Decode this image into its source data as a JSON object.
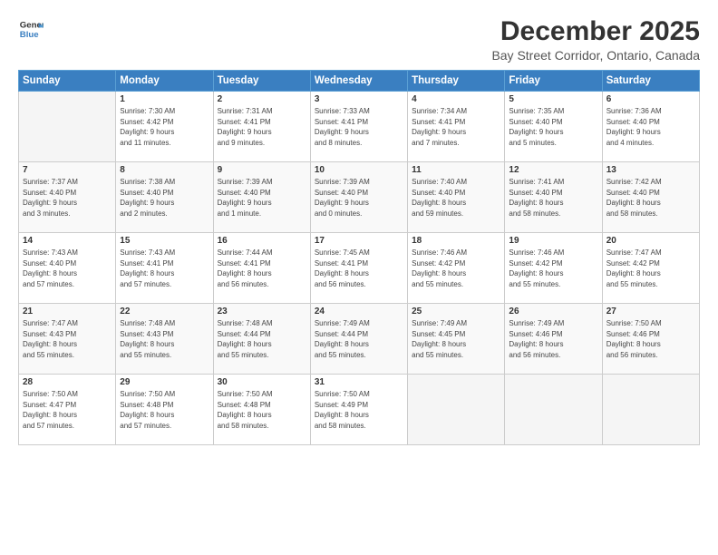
{
  "logo": {
    "general": "General",
    "blue": "Blue"
  },
  "title": "December 2025",
  "subtitle": "Bay Street Corridor, Ontario, Canada",
  "days_header": [
    "Sunday",
    "Monday",
    "Tuesday",
    "Wednesday",
    "Thursday",
    "Friday",
    "Saturday"
  ],
  "weeks": [
    [
      {
        "day": "",
        "info": ""
      },
      {
        "day": "1",
        "info": "Sunrise: 7:30 AM\nSunset: 4:42 PM\nDaylight: 9 hours\nand 11 minutes."
      },
      {
        "day": "2",
        "info": "Sunrise: 7:31 AM\nSunset: 4:41 PM\nDaylight: 9 hours\nand 9 minutes."
      },
      {
        "day": "3",
        "info": "Sunrise: 7:33 AM\nSunset: 4:41 PM\nDaylight: 9 hours\nand 8 minutes."
      },
      {
        "day": "4",
        "info": "Sunrise: 7:34 AM\nSunset: 4:41 PM\nDaylight: 9 hours\nand 7 minutes."
      },
      {
        "day": "5",
        "info": "Sunrise: 7:35 AM\nSunset: 4:40 PM\nDaylight: 9 hours\nand 5 minutes."
      },
      {
        "day": "6",
        "info": "Sunrise: 7:36 AM\nSunset: 4:40 PM\nDaylight: 9 hours\nand 4 minutes."
      }
    ],
    [
      {
        "day": "7",
        "info": "Sunrise: 7:37 AM\nSunset: 4:40 PM\nDaylight: 9 hours\nand 3 minutes."
      },
      {
        "day": "8",
        "info": "Sunrise: 7:38 AM\nSunset: 4:40 PM\nDaylight: 9 hours\nand 2 minutes."
      },
      {
        "day": "9",
        "info": "Sunrise: 7:39 AM\nSunset: 4:40 PM\nDaylight: 9 hours\nand 1 minute."
      },
      {
        "day": "10",
        "info": "Sunrise: 7:39 AM\nSunset: 4:40 PM\nDaylight: 9 hours\nand 0 minutes."
      },
      {
        "day": "11",
        "info": "Sunrise: 7:40 AM\nSunset: 4:40 PM\nDaylight: 8 hours\nand 59 minutes."
      },
      {
        "day": "12",
        "info": "Sunrise: 7:41 AM\nSunset: 4:40 PM\nDaylight: 8 hours\nand 58 minutes."
      },
      {
        "day": "13",
        "info": "Sunrise: 7:42 AM\nSunset: 4:40 PM\nDaylight: 8 hours\nand 58 minutes."
      }
    ],
    [
      {
        "day": "14",
        "info": "Sunrise: 7:43 AM\nSunset: 4:40 PM\nDaylight: 8 hours\nand 57 minutes."
      },
      {
        "day": "15",
        "info": "Sunrise: 7:43 AM\nSunset: 4:41 PM\nDaylight: 8 hours\nand 57 minutes."
      },
      {
        "day": "16",
        "info": "Sunrise: 7:44 AM\nSunset: 4:41 PM\nDaylight: 8 hours\nand 56 minutes."
      },
      {
        "day": "17",
        "info": "Sunrise: 7:45 AM\nSunset: 4:41 PM\nDaylight: 8 hours\nand 56 minutes."
      },
      {
        "day": "18",
        "info": "Sunrise: 7:46 AM\nSunset: 4:42 PM\nDaylight: 8 hours\nand 55 minutes."
      },
      {
        "day": "19",
        "info": "Sunrise: 7:46 AM\nSunset: 4:42 PM\nDaylight: 8 hours\nand 55 minutes."
      },
      {
        "day": "20",
        "info": "Sunrise: 7:47 AM\nSunset: 4:42 PM\nDaylight: 8 hours\nand 55 minutes."
      }
    ],
    [
      {
        "day": "21",
        "info": "Sunrise: 7:47 AM\nSunset: 4:43 PM\nDaylight: 8 hours\nand 55 minutes."
      },
      {
        "day": "22",
        "info": "Sunrise: 7:48 AM\nSunset: 4:43 PM\nDaylight: 8 hours\nand 55 minutes."
      },
      {
        "day": "23",
        "info": "Sunrise: 7:48 AM\nSunset: 4:44 PM\nDaylight: 8 hours\nand 55 minutes."
      },
      {
        "day": "24",
        "info": "Sunrise: 7:49 AM\nSunset: 4:44 PM\nDaylight: 8 hours\nand 55 minutes."
      },
      {
        "day": "25",
        "info": "Sunrise: 7:49 AM\nSunset: 4:45 PM\nDaylight: 8 hours\nand 55 minutes."
      },
      {
        "day": "26",
        "info": "Sunrise: 7:49 AM\nSunset: 4:46 PM\nDaylight: 8 hours\nand 56 minutes."
      },
      {
        "day": "27",
        "info": "Sunrise: 7:50 AM\nSunset: 4:46 PM\nDaylight: 8 hours\nand 56 minutes."
      }
    ],
    [
      {
        "day": "28",
        "info": "Sunrise: 7:50 AM\nSunset: 4:47 PM\nDaylight: 8 hours\nand 57 minutes."
      },
      {
        "day": "29",
        "info": "Sunrise: 7:50 AM\nSunset: 4:48 PM\nDaylight: 8 hours\nand 57 minutes."
      },
      {
        "day": "30",
        "info": "Sunrise: 7:50 AM\nSunset: 4:48 PM\nDaylight: 8 hours\nand 58 minutes."
      },
      {
        "day": "31",
        "info": "Sunrise: 7:50 AM\nSunset: 4:49 PM\nDaylight: 8 hours\nand 58 minutes."
      },
      {
        "day": "",
        "info": ""
      },
      {
        "day": "",
        "info": ""
      },
      {
        "day": "",
        "info": ""
      }
    ]
  ]
}
